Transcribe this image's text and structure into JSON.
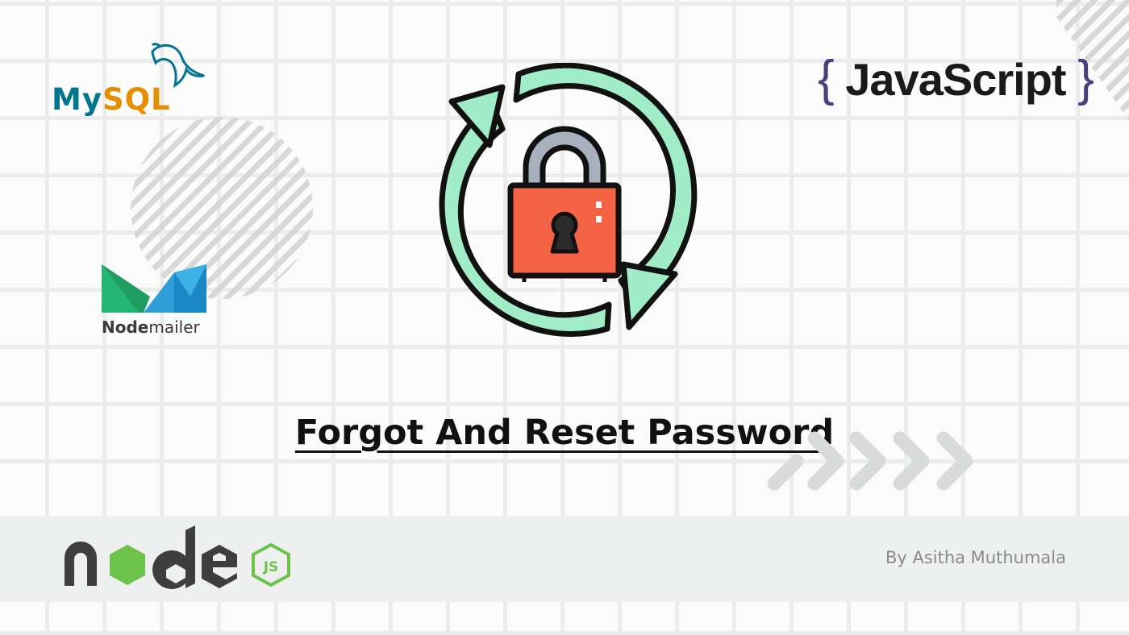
{
  "title": "Forgot And Reset Password",
  "author": "By Asitha Muthumala",
  "logos": {
    "mysql": {
      "my": "My",
      "sql": "SQL",
      "icon": "dolphin-icon"
    },
    "nodemailer": {
      "bold": "Node",
      "regular": "mailer"
    },
    "javascript": {
      "open_brace": "{",
      "text": "JavaScript",
      "close_brace": "}"
    },
    "node": {
      "text": "node",
      "badge": "JS"
    }
  },
  "hero_icon": "lock-refresh-icon",
  "colors": {
    "arrow_green": "#a0edc8",
    "lock_red": "#f46344",
    "shackle_gray": "#a7b0bd",
    "outline": "#111111",
    "mysql_blue": "#00758f",
    "mysql_orange": "#e48e00",
    "node_dark": "#3e3e3e",
    "node_green": "#6cc24a",
    "js_purple": "#4b3f7e"
  }
}
